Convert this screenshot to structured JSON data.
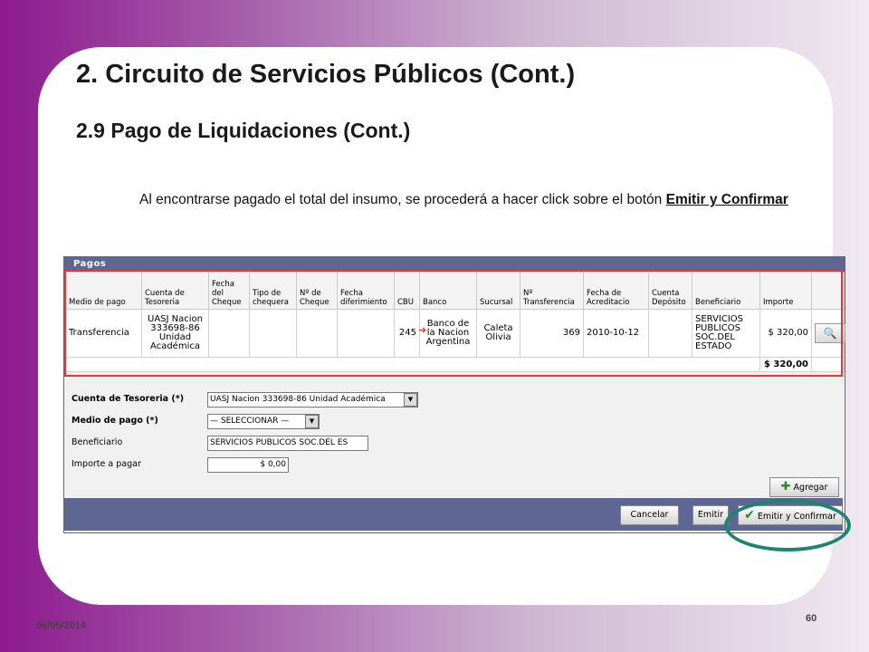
{
  "slide": {
    "title": "2. Circuito de Servicios Públicos (Cont.)",
    "subtitle": "2.9 Pago de Liquidaciones (Cont.)",
    "paragraph_text": "Al encontrarse pagado el total del insumo, se procederá a hacer click sobre el botón",
    "paragraph_link": "Emitir y Confirmar",
    "date": "06/05/2014",
    "page_number": "60"
  },
  "app": {
    "section_title": "Pagos",
    "table": {
      "headers": [
        "Medio de pago",
        "Cuenta de Tesoreria",
        "Fecha del Cheque",
        "Tipo de chequera",
        "Nº de Cheque",
        "Fecha diferimiento",
        "CBU",
        "Banco",
        "Sucursal",
        "Nº Transferencia",
        "Fecha de Acreditacio",
        "Cuenta Depósito",
        "Beneficiario",
        "Importe",
        ""
      ],
      "rows": [
        {
          "medio": "Transferencia",
          "cuenta": "UASJ Nacion 333698-86 Unidad Académica",
          "fecha_cheque": "",
          "tipo_chequera": "",
          "nro_cheque": "",
          "fecha_dif": "",
          "cbu": "245",
          "banco": "Banco de la Nacion Argentina",
          "sucursal": "Caleta Olivia",
          "nro_transf": "369",
          "fecha_acred": "2010-10-12",
          "cuenta_dep": "",
          "beneficiario": "SERVICIOS PUBLICOS SOC.DEL ESTADO",
          "importe": "$ 320,00"
        }
      ],
      "total": "$ 320,00"
    },
    "form": {
      "cuenta_label": "Cuenta de Tesoreria (*)",
      "cuenta_value": "UASJ Nacion 333698-86 Unidad Académica",
      "medio_label": "Medio de pago (*)",
      "medio_value": "— SELECCIONAR —",
      "beneficiario_label": "Beneficiario",
      "beneficiario_value": "SERVICIOS PUBLICOS SOC.DEL ES",
      "importe_label": "Importe a pagar",
      "importe_value": "$ 0,00"
    },
    "buttons": {
      "agregar": "Agregar",
      "cancelar": "Cancelar",
      "emitir": "Emitir",
      "emitir_confirmar": "Emitir y Confirmar"
    },
    "colors": {
      "header_bar": "#5e6794",
      "highlight_box": "#e23a3a",
      "highlight_ring": "#1d8470"
    }
  }
}
